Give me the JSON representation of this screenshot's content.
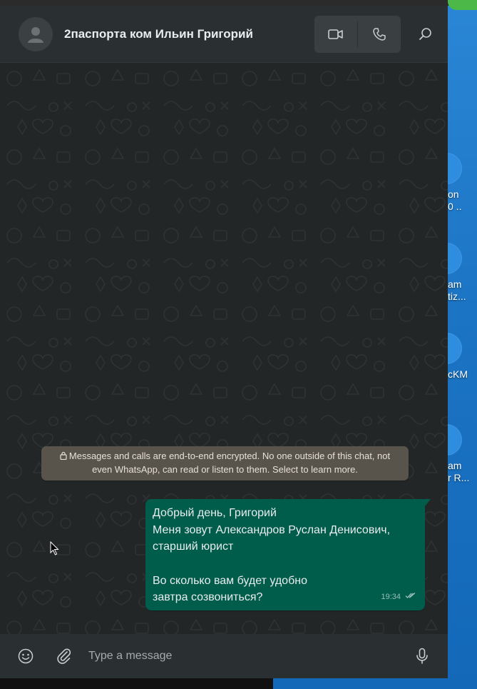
{
  "desktop": {
    "icons": [
      {
        "line1": "on",
        "line2": "0 .."
      },
      {
        "line1": "am",
        "line2": "tiz..."
      },
      {
        "line1": "cKM",
        "line2": ""
      },
      {
        "line1": "am",
        "line2": "r R..."
      }
    ]
  },
  "header": {
    "contact_name": "2паспорта ком Ильин Григорий",
    "icons": {
      "avatar": "default-avatar-icon",
      "video": "video-call-icon",
      "voice": "voice-call-icon",
      "search": "search-icon"
    }
  },
  "chat": {
    "encryption_line1": "Messages and calls are end-to-end encrypted. No one outside of this chat, not",
    "encryption_line2": "even WhatsApp, can read or listen to them. Select to learn more.",
    "messages": [
      {
        "lines": [
          "Добрый день, Григорий",
          "Меня зовут Александров Руслан Денисович,",
          "старший юрист",
          "",
          "Во сколько вам будет удобно",
          "завтра созвониться?"
        ],
        "time": "19:34",
        "status": "delivered"
      }
    ]
  },
  "composer": {
    "placeholder": "Type a message",
    "icons": {
      "emoji": "emoji-icon",
      "attach": "attach-icon",
      "mic": "microphone-icon"
    }
  },
  "colors": {
    "header_bg": "#2a2f32",
    "outgoing_bubble": "#005c4b",
    "encryption_notice": "#58544b",
    "chat_bg": "#232627"
  }
}
